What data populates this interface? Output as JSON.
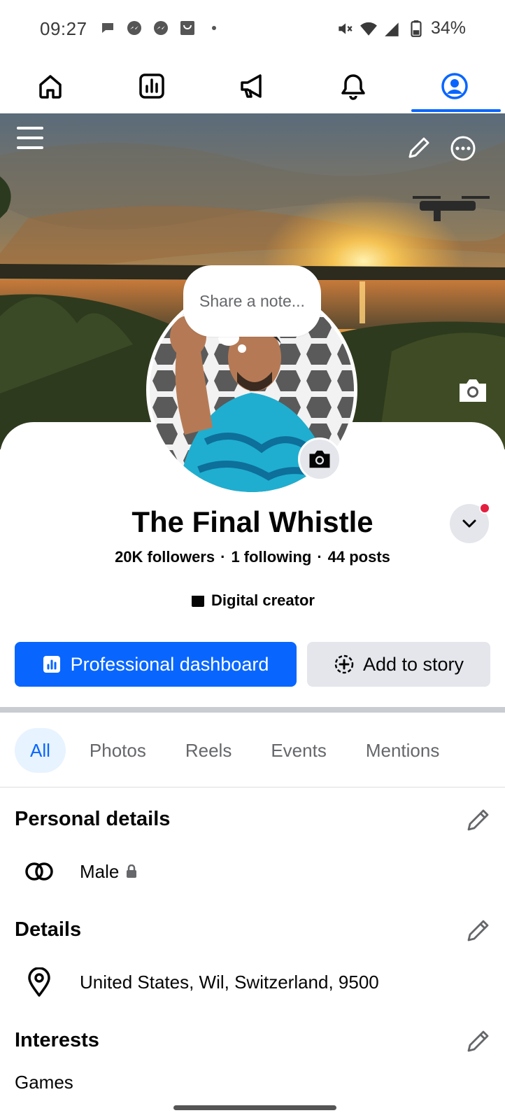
{
  "status_bar": {
    "time": "09:27",
    "notification_icons": [
      "chat-bubble-icon",
      "messenger-icon",
      "messenger-icon",
      "shopping-bag-icon",
      "dot-icon"
    ],
    "battery": "34%"
  },
  "top_nav": {
    "tabs": [
      {
        "name": "home",
        "icon": "home-icon",
        "active": false
      },
      {
        "name": "dashboard",
        "icon": "bar-chart-icon",
        "active": false
      },
      {
        "name": "ads",
        "icon": "megaphone-icon",
        "active": false
      },
      {
        "name": "notifications",
        "icon": "bell-icon",
        "active": false
      },
      {
        "name": "profile",
        "icon": "profile-icon",
        "active": true
      }
    ],
    "accent_color": "#0866ff"
  },
  "cover": {
    "menu_icon": "hamburger-icon",
    "edit_icon": "pencil-icon",
    "more_icon": "more-icon",
    "camera_icon": "camera-icon"
  },
  "note": {
    "placeholder": "Share a note..."
  },
  "profile": {
    "name": "The Final Whistle",
    "followers": "20K followers",
    "following": "1 following",
    "posts": "44 posts",
    "separator": "·",
    "category": "Digital creator"
  },
  "actions": {
    "primary_label": "Professional dashboard",
    "secondary_label": "Add to story"
  },
  "filters": {
    "chips": [
      "All",
      "Photos",
      "Reels",
      "Events",
      "Mentions"
    ],
    "active_index": 0
  },
  "sections": {
    "personal_details": {
      "title": "Personal details",
      "gender": "Male"
    },
    "details": {
      "title": "Details",
      "location": "United States, Wil, Switzerland, 9500"
    },
    "interests": {
      "title": "Interests",
      "first_item": "Games"
    }
  }
}
